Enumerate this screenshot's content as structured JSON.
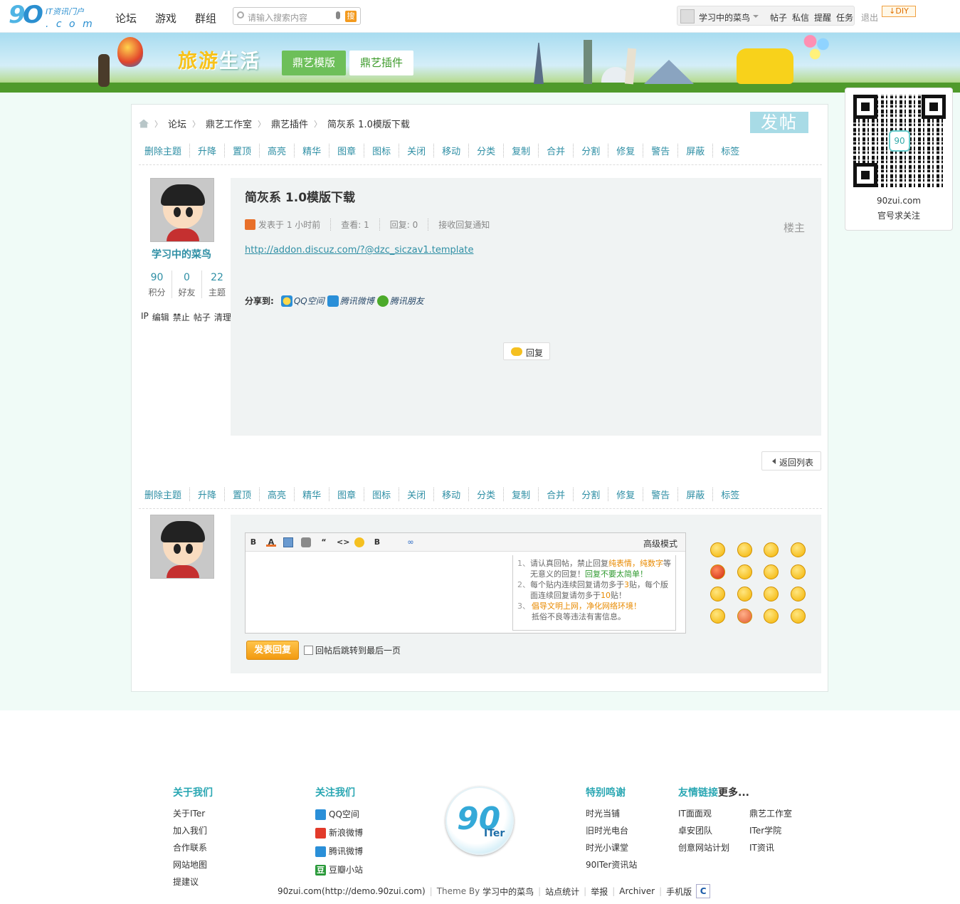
{
  "site": {
    "logo_text": "IT资讯门户",
    "logo_sub": "90ITer.com",
    "nav": [
      "论坛",
      "游戏",
      "群组"
    ],
    "search_placeholder": "请输入搜索内容",
    "search_button": "搜",
    "user": {
      "name": "学习中的菜鸟",
      "links": [
        "帖子",
        "私信",
        "提醒",
        "任务"
      ],
      "logout": "退出",
      "diy": "DIY"
    }
  },
  "banner": {
    "title_a": "旅游",
    "title_b": "生活",
    "buttons": [
      "鼎艺模版",
      "鼎艺插件"
    ]
  },
  "breadcrumb": [
    "论坛",
    "鼎艺工作室",
    "鼎艺插件",
    "简灰系 1.0模版下载"
  ],
  "post_button": "发帖",
  "mod_actions": [
    "删除主题",
    "升降",
    "置顶",
    "高亮",
    "精华",
    "图章",
    "图标",
    "关闭",
    "移动",
    "分类",
    "复制",
    "合并",
    "分割",
    "修复",
    "警告",
    "屏蔽",
    "标签"
  ],
  "author": {
    "name": "学习中的菜鸟",
    "stats": [
      {
        "value": "90",
        "label": "积分"
      },
      {
        "value": "0",
        "label": "好友"
      },
      {
        "value": "22",
        "label": "主题"
      }
    ],
    "admin_links": [
      "IP",
      "编辑",
      "禁止",
      "帖子",
      "清理"
    ]
  },
  "post": {
    "title": "简灰系 1.0模版下载",
    "meta": [
      "发表于 1 小时前",
      "查看: 1",
      "回复: 0",
      "接收回复通知"
    ],
    "floor": "楼主",
    "link": "http://addon.discuz.com/?@dzc_siczav1.template",
    "share_label": "分享到:",
    "share": [
      "QQ空间",
      "腾讯微博",
      "腾讯朋友"
    ],
    "reply_button": "回复"
  },
  "back_button": "返回列表",
  "editor": {
    "advanced_mode": "高级模式",
    "tips": [
      {
        "n": "1、",
        "parts": [
          {
            "t": "请认真回帖，禁止回复",
            "c": ""
          },
          {
            "t": "纯表情，纯数字",
            "c": "hl"
          },
          {
            "t": "等无意义的回复！",
            "c": ""
          },
          {
            "t": "回复不要太简单！",
            "c": "hg"
          }
        ]
      },
      {
        "n": "2、",
        "parts": [
          {
            "t": "每个贴内连续回复请勿多于",
            "c": ""
          },
          {
            "t": "3",
            "c": "hl"
          },
          {
            "t": "贴，每个版面连续回复请勿多于",
            "c": ""
          },
          {
            "t": "10",
            "c": "hl"
          },
          {
            "t": "贴！",
            "c": ""
          }
        ]
      },
      {
        "n": "3、",
        "parts": [
          {
            "t": "倡导文明上网，净化网络环境！",
            "c": "hl"
          },
          {
            "t": "抵俗不良等违法有害信息。",
            "c": ""
          }
        ]
      }
    ],
    "submit": "发表回复",
    "jump_label": "回帖后跳转到最后一页"
  },
  "qr": {
    "site": "90zui.com",
    "tagline": "官号求关注",
    "logo": "90"
  },
  "footer": {
    "about": {
      "title": "关于我们",
      "items": [
        "关于ITer",
        "加入我们",
        "合作联系",
        "网站地图",
        "提建议"
      ]
    },
    "follow": {
      "title": "关注我们",
      "items": [
        "QQ空间",
        "新浪微博",
        "腾讯微博",
        "豆瓣小站"
      ]
    },
    "thanks": {
      "title": "特别鸣谢",
      "items": [
        "时光当铺",
        "旧时光电台",
        "时光小课堂",
        "90ITer资讯站"
      ]
    },
    "links": {
      "title": "友情链接",
      "more": "更多...",
      "col1": [
        "IT面面观",
        "卓安团队",
        "创意网站计划"
      ],
      "col2": [
        "鼎艺工作室",
        "ITer学院",
        "IT资讯"
      ]
    },
    "logo_text": "90",
    "logo_sub": "ITer",
    "copyright": {
      "site": "90zui.com(http://demo.90zui.com)",
      "theme_label": "Theme By",
      "theme_author": "学习中的菜鸟",
      "links": [
        "站点统计",
        "举报",
        "Archiver",
        "手机版"
      ],
      "cnzz": "C"
    }
  },
  "colors": {
    "accent": "#2f8fa5",
    "button_green": "#6dbf5a",
    "submit_orange": "#f29a10",
    "page_bg": "#f0fbf7"
  }
}
